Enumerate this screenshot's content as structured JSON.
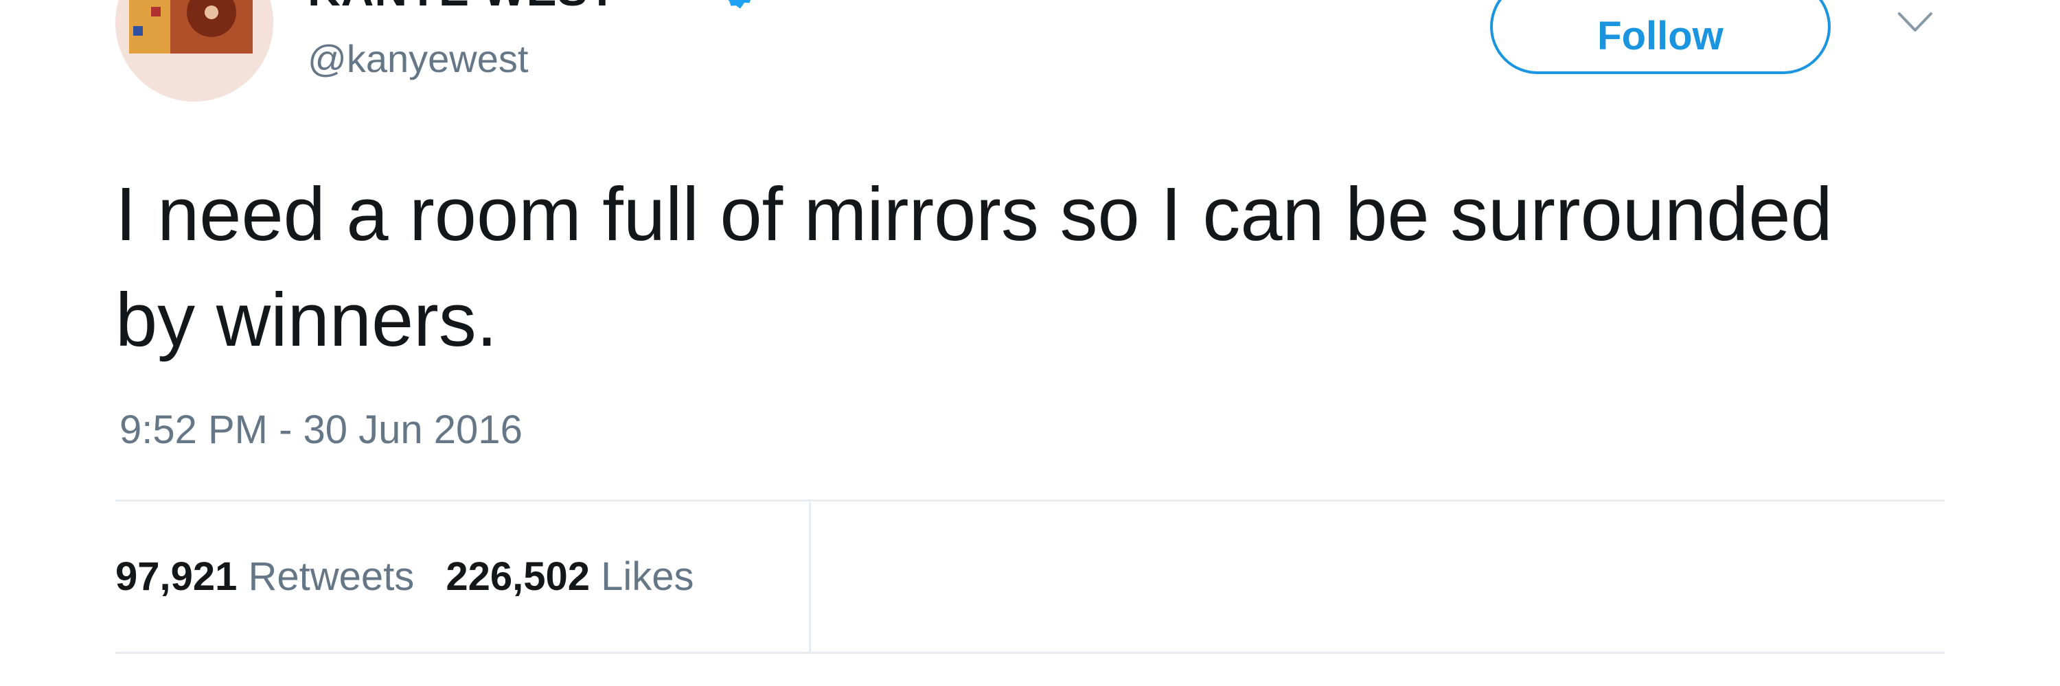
{
  "author": {
    "display_name": "KANYE WEST",
    "screen_name": "@kanyewest",
    "avatar_icon": "avatar-image",
    "verified_icon": "verified-badge-icon"
  },
  "actions": {
    "follow_label": "Follow",
    "menu_icon": "chevron-down-icon"
  },
  "tweet": {
    "text": "I need a room full of mirrors so I can be surrounded by winners.",
    "timestamp": "9:52 PM - 30 Jun 2016"
  },
  "stats": {
    "retweets_count": "97,921",
    "retweets_label": "Retweets",
    "likes_count": "226,502",
    "likes_label": "Likes"
  },
  "colors": {
    "accent": "#1b95e0",
    "secondary_text": "#657786",
    "primary_text": "#14171a",
    "divider": "#e6ecf0"
  }
}
